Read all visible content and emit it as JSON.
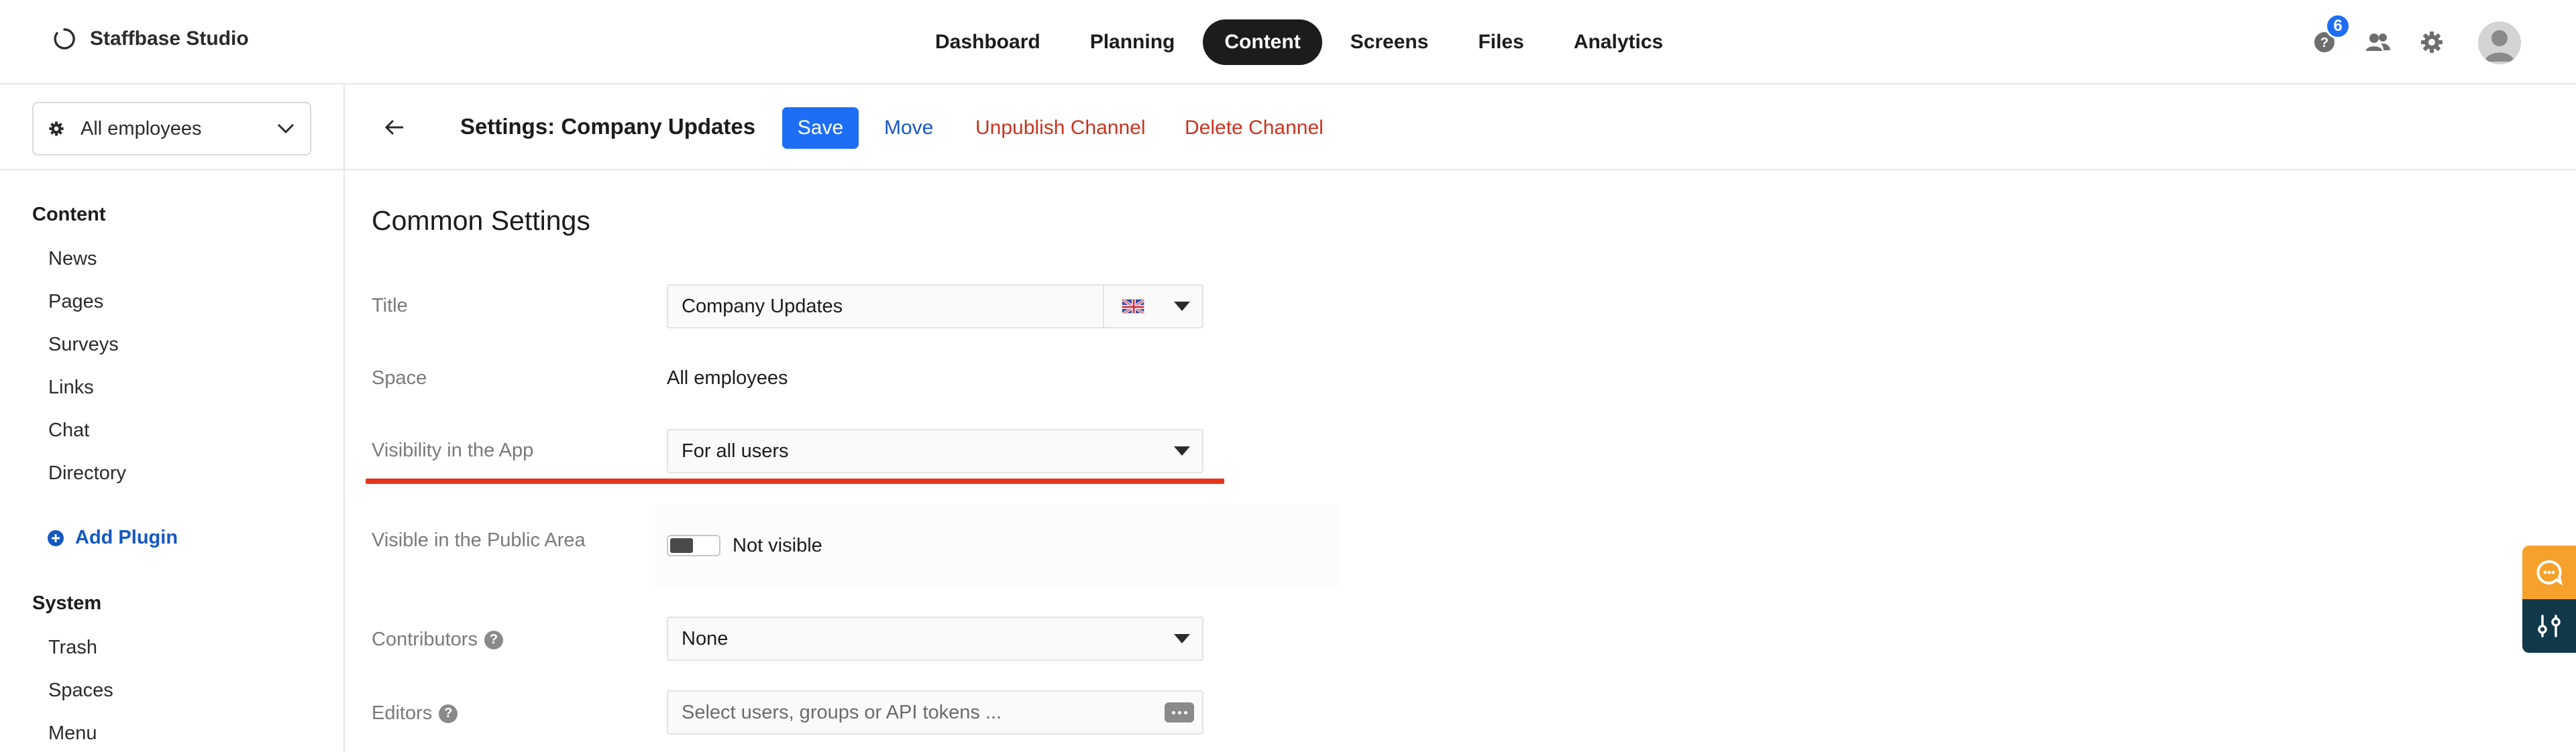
{
  "app": {
    "name": "Staffbase Studio",
    "notification_count": "6"
  },
  "nav": {
    "items": [
      {
        "label": "Dashboard"
      },
      {
        "label": "Planning"
      },
      {
        "label": "Content",
        "active": true
      },
      {
        "label": "Screens"
      },
      {
        "label": "Files"
      },
      {
        "label": "Analytics"
      }
    ]
  },
  "icons": {
    "logo": "staffbase-logo-icon",
    "help": "help-icon",
    "users": "users-icon",
    "settings": "gear-icon",
    "avatar": "user-avatar-icon",
    "back": "arrow-left-icon",
    "chat": "chat-widget-icon",
    "tools": "sliders-icon"
  },
  "colors": {
    "primary": "#1e6ef5",
    "link": "#1557c2",
    "danger": "#c9331f",
    "highlight_underline": "#e8331c",
    "chat_widget": "#f6a12b",
    "tools_widget": "#12394a"
  },
  "sidebar": {
    "space_selector": "All employees",
    "content_heading": "Content",
    "content_items": [
      {
        "label": "News"
      },
      {
        "label": "Pages"
      },
      {
        "label": "Surveys"
      },
      {
        "label": "Links"
      },
      {
        "label": "Chat"
      },
      {
        "label": "Directory"
      }
    ],
    "add_plugin": "Add Plugin",
    "system_heading": "System",
    "system_items": [
      {
        "label": "Trash"
      },
      {
        "label": "Spaces"
      },
      {
        "label": "Menu"
      }
    ]
  },
  "header": {
    "title": "Settings: Company Updates",
    "save": "Save",
    "move": "Move",
    "unpublish": "Unpublish Channel",
    "delete": "Delete Channel"
  },
  "settings": {
    "section_title": "Common Settings",
    "title_label": "Title",
    "title_value": "Company Updates",
    "space_label": "Space",
    "space_value": "All employees",
    "visibility_label": "Visibility in the App",
    "visibility_value": "For all users",
    "public_label": "Visible in the Public Area",
    "public_value": "Not visible",
    "public_toggle_on": false,
    "contributors_label": "Contributors",
    "contributors_value": "None",
    "editors_label": "Editors",
    "editors_placeholder": "Select users, groups or API tokens ..."
  }
}
